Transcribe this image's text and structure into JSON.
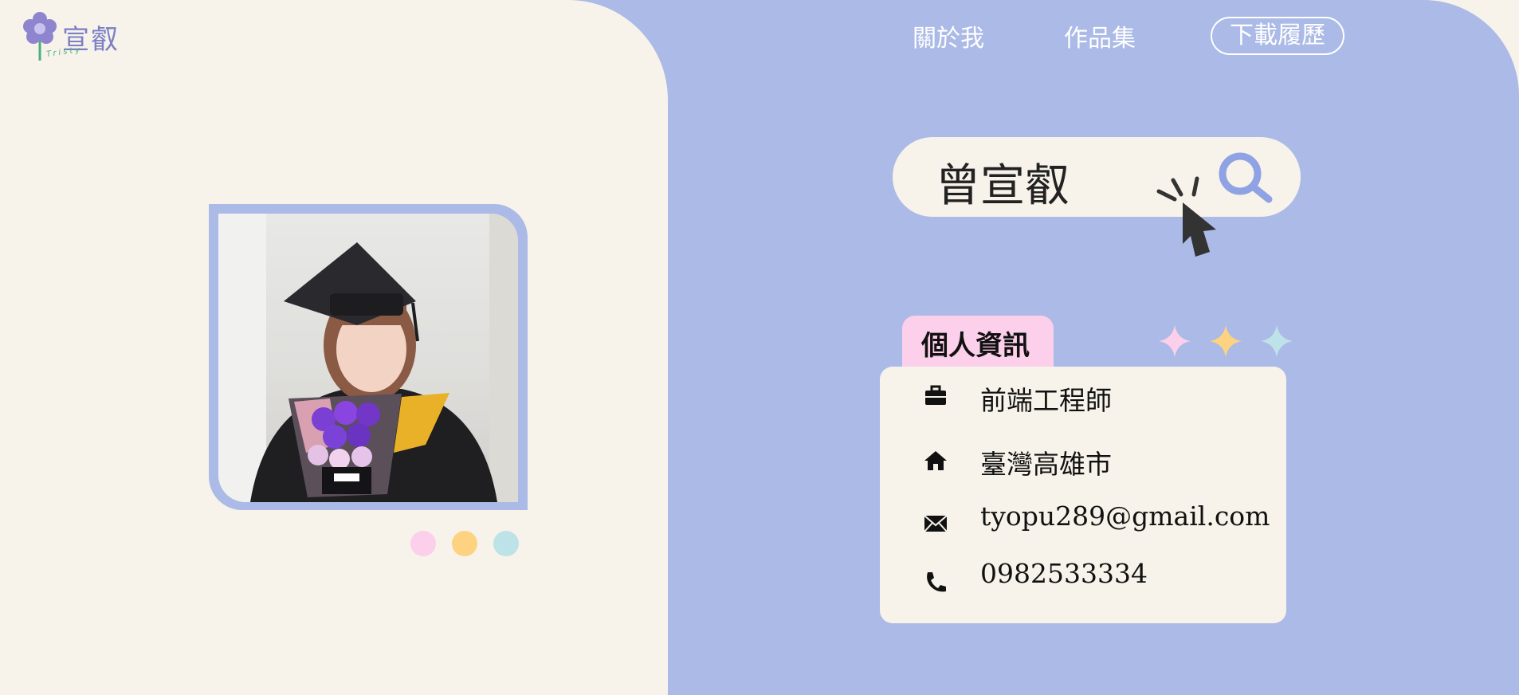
{
  "logo": {
    "cn": "宣叡",
    "en": "Tristy"
  },
  "nav": {
    "about": "關於我",
    "portfolio": "作品集",
    "resume": "下載履歷"
  },
  "search": {
    "name": "曾宣叡"
  },
  "info": {
    "tab": "個人資訊",
    "job": "前端工程師",
    "location": "臺灣高雄市",
    "email": "tyopu289@gmail.com",
    "phone": "0982533334"
  },
  "colors": {
    "accent_blue": "#abbae6",
    "cream": "#f7f3ea",
    "pink": "#fccfea",
    "yellow": "#fdd381",
    "teal": "#bde3e8"
  }
}
